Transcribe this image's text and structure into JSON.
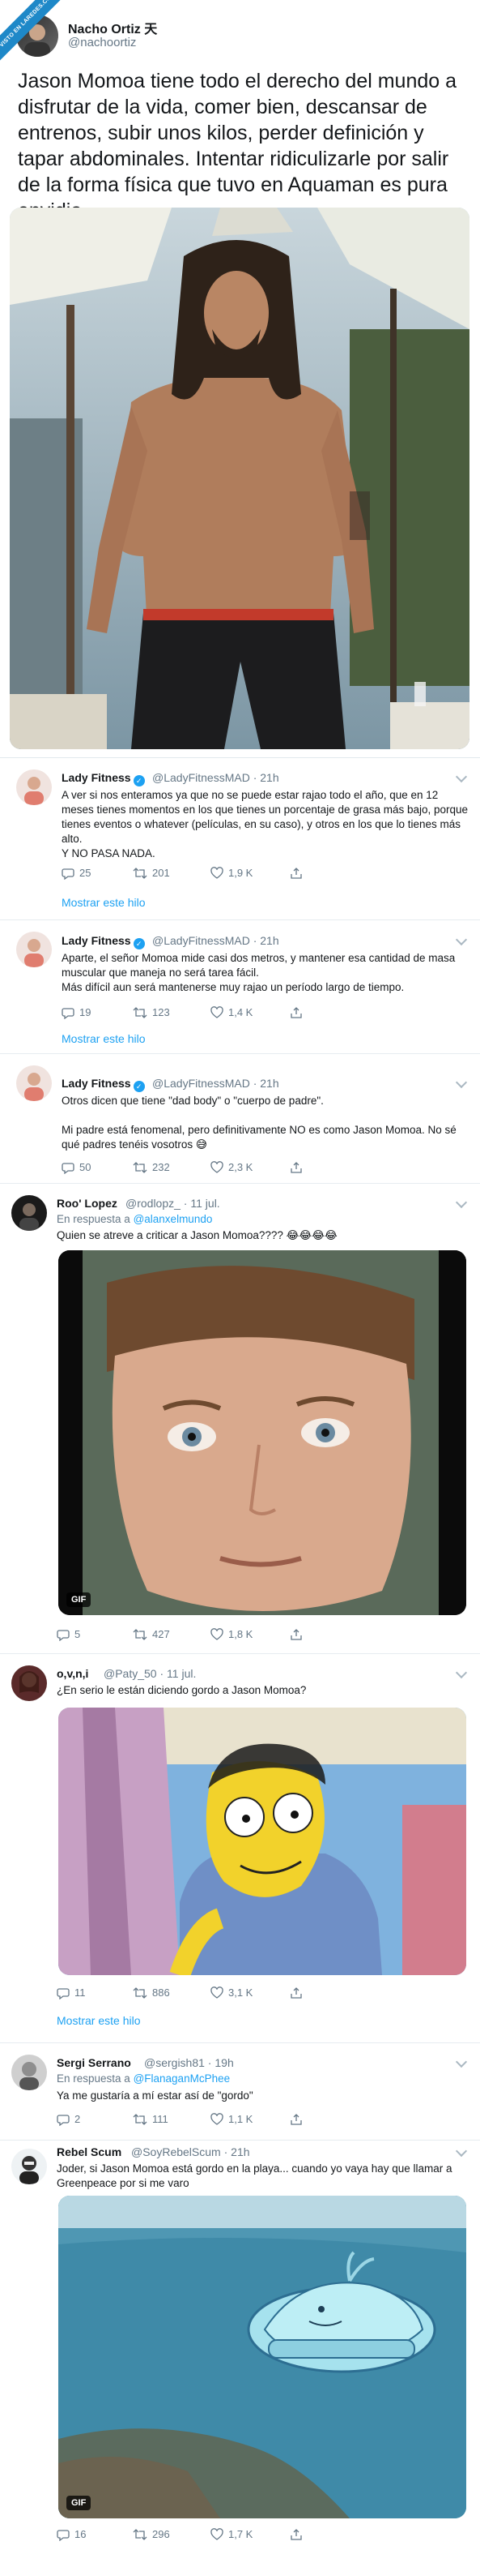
{
  "watermark": "VISTO EN LAREDES.COM",
  "tweet": {
    "name": "Nacho Ortiz",
    "name_glyph": "天",
    "handle": "@nachoortiz",
    "text": "Jason Momoa tiene todo el derecho del mundo a disfrutar de la vida, comer bien, descansar de entrenos, subir unos kilos, perder definición y tapar abdominales. Intentar ridiculizarle por salir de la forma física que tuvo en Aquaman es pura envidia."
  },
  "replies": [
    {
      "name": "Lady Fitness",
      "handle": "@LadyFitnessMAD",
      "time": "21h",
      "verified": true,
      "text": "A ver si nos enteramos ya que no se puede estar rajao todo el año, que en 12 meses tienes momentos en los que tienes un porcentaje de grasa más bajo, porque tienes eventos o whatever (películas, en su caso), y otros en los que lo tienes más alto.\nY NO PASA NADA.",
      "replies": "25",
      "retweets": "201",
      "likes": "1,9 K",
      "show_thread": "Mostrar este hilo"
    },
    {
      "name": "Lady Fitness",
      "handle": "@LadyFitnessMAD",
      "time": "21h",
      "verified": true,
      "text": "Aparte, el señor Momoa mide casi dos metros, y mantener esa cantidad de masa muscular que maneja no será tarea fácil.\nMás difícil aun será mantenerse muy rajao un período largo de tiempo.",
      "replies": "19",
      "retweets": "123",
      "likes": "1,4 K",
      "show_thread": "Mostrar este hilo"
    },
    {
      "name": "Lady Fitness",
      "handle": "@LadyFitnessMAD",
      "time": "21h",
      "verified": true,
      "text": "Otros dicen que tiene \"dad body\" o \"cuerpo de padre\".\n\nMi padre está fenomenal, pero definitivamente NO es como Jason Momoa. No sé qué padres tenéis vosotros 😅",
      "replies": "50",
      "retweets": "232",
      "likes": "2,3 K"
    },
    {
      "name": "Roo' Lopez",
      "handle": "@rodlopz_",
      "time": "11 jul.",
      "in_reply_prefix": "En respuesta a",
      "in_reply_to": "@alanxelmundo",
      "text": "Quien se atreve a criticar a Jason Momoa???? 😂😂😂😂",
      "gif_badge": "GIF",
      "replies": "5",
      "retweets": "427",
      "likes": "1,8 K"
    },
    {
      "name": "o,v,n,i",
      "handle": "@Paty_50",
      "time": "11 jul.",
      "text": "¿En serio le están diciendo gordo a Jason Momoa?",
      "replies": "11",
      "retweets": "886",
      "likes": "3,1 K",
      "show_thread": "Mostrar este hilo"
    },
    {
      "name": "Sergi Serrano",
      "handle": "@sergish81",
      "time": "19h",
      "in_reply_prefix": "En respuesta a",
      "in_reply_to": "@FlanaganMcPhee",
      "text": "Ya me gustaría a mí estar así de \"gordo\"",
      "replies": "2",
      "retweets": "111",
      "likes": "1,1 K"
    },
    {
      "name": "Rebel Scum",
      "handle": "@SoyRebelScum",
      "time": "21h",
      "text": "Joder, si Jason Momoa está gordo en la playa... cuando yo vaya hay que llamar a Greenpeace por si me varo",
      "gif_badge": "GIF",
      "replies": "16",
      "retweets": "296",
      "likes": "1,7 K"
    }
  ]
}
